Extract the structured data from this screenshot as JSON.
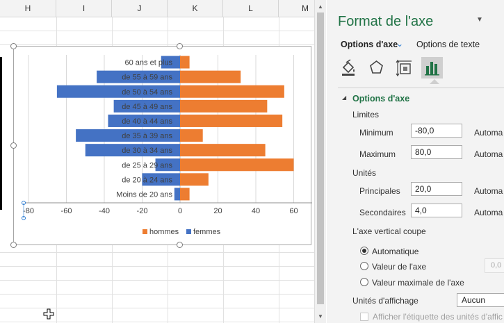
{
  "sheet": {
    "columns": [
      "H",
      "I",
      "J",
      "K",
      "L",
      "M"
    ]
  },
  "chart_data": {
    "type": "bar",
    "orientation": "horizontal",
    "categories": [
      "60 ans et plus",
      "de 55 à 59 ans",
      "de 50 à 54 ans",
      "de 45 à 49 ans",
      "de 40 à 44 ans",
      "de 35 à 39 ans",
      "de 30 à 34 ans",
      "de 25 à 29 ans",
      "de 20 à 24 ans",
      "Moins de 20 ans"
    ],
    "series": [
      {
        "name": "hommes",
        "values": [
          5,
          32,
          55,
          46,
          54,
          12,
          45,
          60,
          15,
          5
        ],
        "color": "#ed7d31"
      },
      {
        "name": "femmes",
        "values": [
          -10,
          -44,
          -65,
          -35,
          -38,
          -55,
          -50,
          -13,
          -20,
          -3
        ],
        "color": "#4472c4"
      }
    ],
    "xticks": [
      "-80",
      "-60",
      "-40",
      "-20",
      "0",
      "20",
      "40",
      "60"
    ],
    "xlim": [
      -80,
      80
    ],
    "grid": true,
    "legend": "bottom"
  },
  "pane": {
    "title": "Format de l'axe",
    "tabs": {
      "axis_options": "Options d'axe",
      "text_options": "Options de texte"
    },
    "icons": [
      "fill-line-icon",
      "effects-icon",
      "size-properties-icon",
      "axis-options-icon"
    ],
    "section_title": "Options d'axe",
    "limits_label": "Limites",
    "minimum_label": "Minimum",
    "minimum_value": "-80,0",
    "maximum_label": "Maximum",
    "maximum_value": "80,0",
    "units_label": "Unités",
    "major_label": "Principales",
    "major_value": "20,0",
    "minor_label": "Secondaires",
    "minor_value": "4,0",
    "auto_label": "Automa",
    "cross_label": "L'axe vertical coupe",
    "radio_auto": "Automatique",
    "radio_value": "Valeur de l'axe",
    "radio_max": "Valeur maximale de l'axe",
    "value_partial": "0,0",
    "display_units_label": "Unités d'affichage",
    "display_units_value": "Aucun",
    "display_units_check": "Afficher l'étiquette des unités d'affic"
  }
}
